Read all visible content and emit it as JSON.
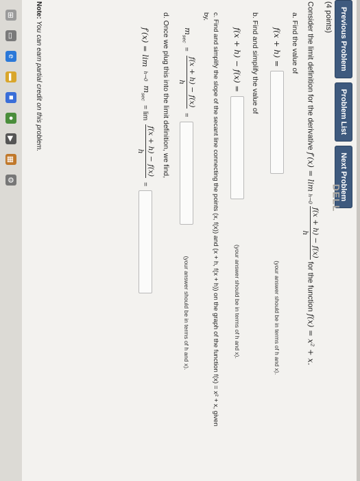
{
  "nav": {
    "previous": "Previous Problem",
    "list": "Problem List",
    "next": "Next Problem"
  },
  "points": "(4 points)",
  "intro": {
    "prefix": "Consider the limit definition for the derivative",
    "fprime": "f′(x) = lim",
    "lim_sub": "h→0",
    "frac_num": "f(x + h) − f(x)",
    "frac_den": "h",
    "suffix": "for the function",
    "function": "f(x) = x² + x."
  },
  "part_a": {
    "label": "a. Find the value of",
    "expr": "f(x + h) =",
    "hint": "(your answer should be in terms of h and x)."
  },
  "part_b": {
    "label": "b. Find and simplify the value of",
    "expr": "f(x + h) − f(x) =",
    "hint": "(your answer should be in terms of h and x)."
  },
  "part_c": {
    "label": "c. Find and simplify the slope of the secant line connecting the points (x, f(x)) and (x + h, f(x + h)) on the graph of the function f(x) = x² + x, given",
    "label2": "by,",
    "msec": "m",
    "msec_sub": "sec",
    "eq": "=",
    "frac_num": "f(x + h) − f(x)",
    "frac_den": "h",
    "eq2": "=",
    "hint": "(your answer should be in terms of h and x)."
  },
  "part_d": {
    "label": "d. Once we plug this into the limit definition, we find,",
    "fprime": "f′(x) = lim",
    "lim_sub": "h→0",
    "msec": "m",
    "msec_sub": "sec",
    "eq": "= lim",
    "frac_num": "f(x + h) − f(x)",
    "frac_den": "h",
    "eq2": "="
  },
  "note": {
    "bold": "Note:",
    "text": "You can earn partial credit on this problem."
  },
  "brand": "DELL"
}
